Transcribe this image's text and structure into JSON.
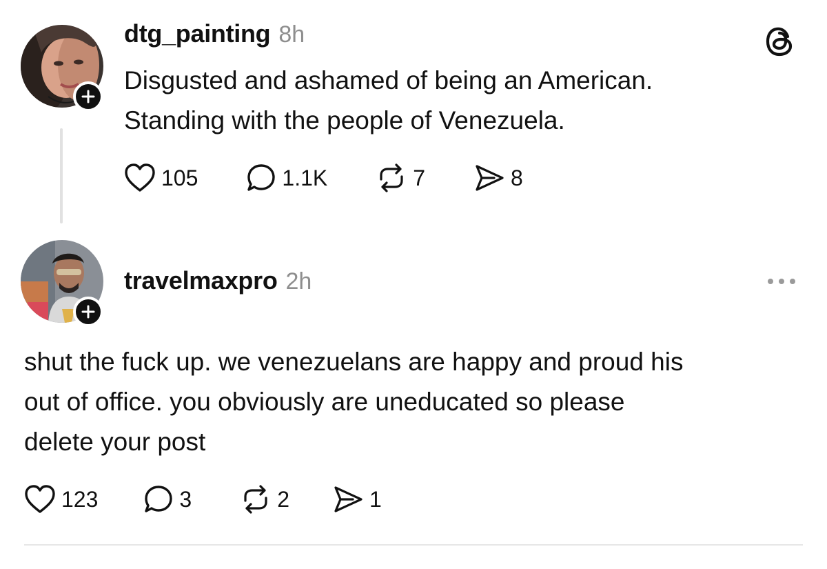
{
  "posts": [
    {
      "username": "dtg_painting",
      "timestamp": "8h",
      "text": "Disgusted and ashamed of being an American.\nStanding with the people of Venezuela.",
      "likes": "105",
      "replies": "1.1K",
      "reposts": "7",
      "shares": "8"
    },
    {
      "username": "travelmaxpro",
      "timestamp": "2h",
      "text": "shut the fuck up. we venezuelans are happy and proud his\nout of office. you obviously are uneducated so please\ndelete your post",
      "likes": "123",
      "replies": "3",
      "reposts": "2",
      "shares": "1"
    }
  ],
  "icons": {
    "app_logo": "threads-logo-icon",
    "follow": "plus-icon",
    "like": "heart-icon",
    "reply": "comment-icon",
    "repost": "repost-icon",
    "share": "send-icon",
    "more": "more-icon"
  },
  "colors": {
    "text": "#111111",
    "secondary_text": "#8e8e8e",
    "background": "#ffffff",
    "divider": "#e6e6e6"
  }
}
